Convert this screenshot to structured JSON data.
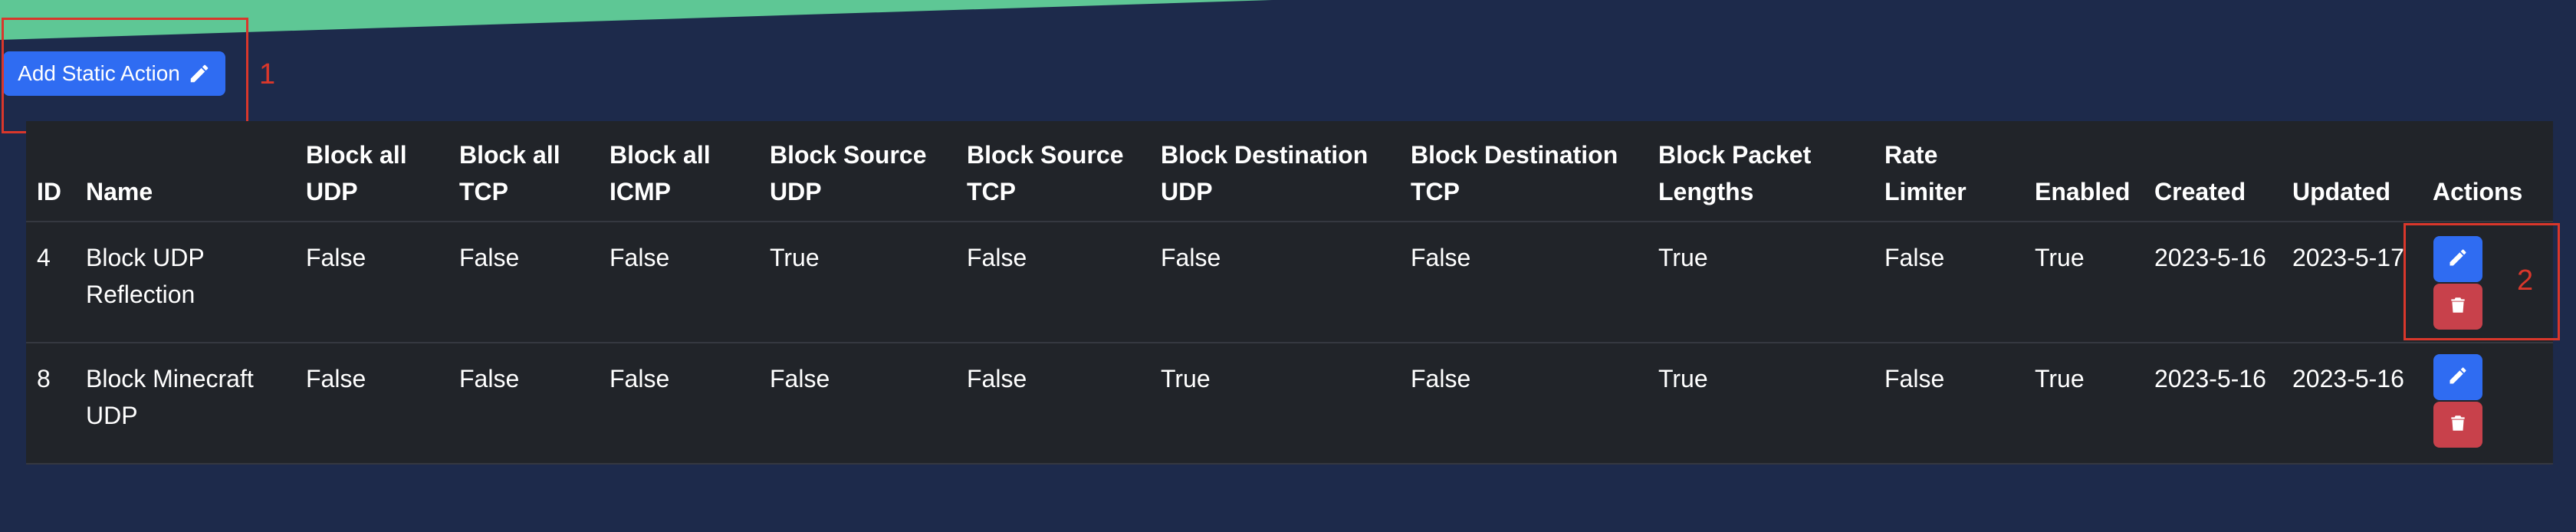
{
  "toolbar": {
    "add_label": "Add Static Action"
  },
  "annotations": {
    "label_1": "1",
    "label_2": "2"
  },
  "table": {
    "headers": {
      "id": "ID",
      "name": "Name",
      "block_udp": "Block all UDP",
      "block_tcp": "Block all TCP",
      "block_icmp": "Block all ICMP",
      "block_src_udp": "Block Source UDP",
      "block_src_tcp": "Block Source TCP",
      "block_dst_udp": "Block Destination UDP",
      "block_dst_tcp": "Block Destination TCP",
      "block_pkt_len": "Block Packet Lengths",
      "rate_limiter": "Rate Limiter",
      "enabled": "Enabled",
      "created": "Created",
      "updated": "Updated",
      "actions": "Actions"
    },
    "rows": [
      {
        "id": "4",
        "name": "Block UDP Reflection",
        "block_udp": "False",
        "block_tcp": "False",
        "block_icmp": "False",
        "block_src_udp": "True",
        "block_src_tcp": "False",
        "block_dst_udp": "False",
        "block_dst_tcp": "False",
        "block_pkt_len": "True",
        "rate_limiter": "False",
        "enabled": "True",
        "created": "2023-5-16",
        "updated": "2023-5-17"
      },
      {
        "id": "8",
        "name": "Block Minecraft UDP",
        "block_udp": "False",
        "block_tcp": "False",
        "block_icmp": "False",
        "block_src_udp": "False",
        "block_src_tcp": "False",
        "block_dst_udp": "True",
        "block_dst_tcp": "False",
        "block_pkt_len": "True",
        "rate_limiter": "False",
        "enabled": "True",
        "created": "2023-5-16",
        "updated": "2023-5-16"
      }
    ]
  },
  "icons": {
    "edit": "pencil-icon",
    "delete": "trash-icon"
  },
  "colors": {
    "page_bg": "#1d2a4b",
    "table_bg": "#212429",
    "primary": "#2f6cf2",
    "danger": "#c8414b",
    "annotation": "#d9372b",
    "top_stripe": "#5ec795"
  }
}
